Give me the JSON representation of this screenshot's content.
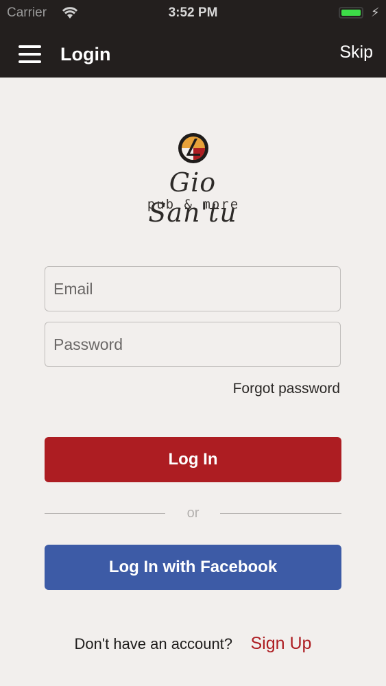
{
  "status_bar": {
    "carrier": "Carrier",
    "time": "3:52 PM",
    "battery_color": "#3ddc48"
  },
  "nav": {
    "title": "Login",
    "skip_label": "Skip",
    "menu_icon": "hamburger-icon"
  },
  "logo": {
    "name": "Gio San'tu",
    "tagline": "pub & more"
  },
  "form": {
    "email_placeholder": "Email",
    "email_value": "",
    "password_placeholder": "Password",
    "password_value": "",
    "forgot_label": "Forgot password",
    "login_label": "Log In",
    "or_label": "or",
    "facebook_label": "Log In with Facebook"
  },
  "footer": {
    "question": "Don't have an account?",
    "signup_label": "Sign Up"
  },
  "colors": {
    "header_bg": "#231f1e",
    "page_bg": "#f2efed",
    "primary_red": "#ad1d22",
    "facebook_blue": "#3d5ba6"
  }
}
